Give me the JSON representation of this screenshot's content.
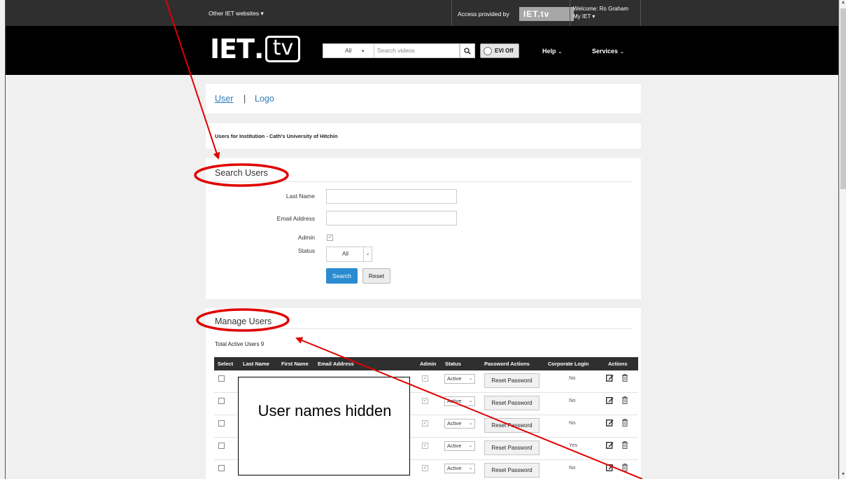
{
  "topbar": {
    "other_sites": "Other IET websites",
    "access_text": "Access provided by",
    "access_logo": "IET.tv",
    "welcome": "Welcome: Ro Graham",
    "my_iet": "My IET"
  },
  "header": {
    "logo_iet": "IET",
    "logo_tv": "tv",
    "search_scope": "All",
    "search_placeholder": "Search videos",
    "evi_label": "EVI Off",
    "nav_help": "Help",
    "nav_services": "Services"
  },
  "tabs": {
    "user": "User",
    "separator": "|",
    "logo": "Logo"
  },
  "institution": {
    "text": "Users for Institution - Cath's University of Hitchin"
  },
  "search_users": {
    "title": "Search Users",
    "last_name_label": "Last Name",
    "last_name_value": "",
    "email_label": "Email Address",
    "email_value": "",
    "admin_label": "Admin",
    "admin_checked": true,
    "status_label": "Status",
    "status_value": "All",
    "search_button": "Search",
    "reset_button": "Reset"
  },
  "manage_users": {
    "title": "Manage Users",
    "total_text": "Total Active Users 9",
    "columns": [
      "Select",
      "Last Name",
      "First Name",
      "Email Address",
      "Admin",
      "Status",
      "Password Actions",
      "Corporate Login",
      "Actions"
    ],
    "rows": [
      {
        "admin": true,
        "status": "Active",
        "password_action": "Reset Password",
        "corporate_login": "No"
      },
      {
        "admin": true,
        "status": "Active",
        "password_action": "Reset Password",
        "corporate_login": "No"
      },
      {
        "admin": true,
        "status": "Active",
        "password_action": "Reset Password",
        "corporate_login": "No"
      },
      {
        "admin": true,
        "status": "Active",
        "password_action": "Reset Password",
        "corporate_login": "Yes"
      },
      {
        "admin": true,
        "status": "Active",
        "password_action": "Reset Password",
        "corporate_login": "No"
      }
    ]
  },
  "overlay": {
    "hidden_note": "User names hidden"
  },
  "colors": {
    "accent": "#2a8bd1",
    "annotation": "#e00000",
    "header_bg": "#000000",
    "topbar_bg": "#2f2f2f"
  }
}
